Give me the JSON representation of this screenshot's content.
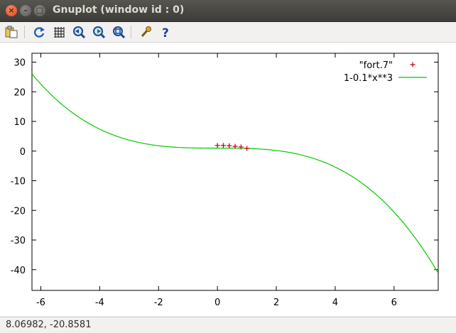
{
  "window": {
    "title": "Gnuplot (window id : 0)",
    "close_glyph": "×",
    "min_glyph": "–",
    "max_glyph": "□"
  },
  "toolbar": {
    "items": [
      {
        "name": "copy-to-clipboard",
        "icon": "clipboard-icon"
      },
      {
        "name": "replot",
        "icon": "refresh-icon"
      },
      {
        "name": "toggle-grid",
        "icon": "grid-icon"
      },
      {
        "name": "previous-zoom",
        "icon": "zoom-back-icon"
      },
      {
        "name": "next-zoom",
        "icon": "zoom-forward-icon"
      },
      {
        "name": "autoscale",
        "icon": "zoom-fit-icon"
      },
      {
        "name": "preferences",
        "icon": "wrench-icon"
      },
      {
        "name": "help",
        "icon": "question-icon"
      }
    ]
  },
  "status": {
    "coords": "8.06982, -20.8581"
  },
  "chart_data": {
    "type": "line",
    "xlim": [
      -6.3,
      7.5
    ],
    "ylim": [
      -47,
      33
    ],
    "xticks": [
      -6,
      -4,
      -2,
      0,
      2,
      4,
      6
    ],
    "yticks": [
      30,
      20,
      10,
      0,
      -10,
      -20,
      -30,
      -40
    ],
    "xtick_labels": [
      "-6",
      "-4",
      "-2",
      "0",
      "2",
      "4",
      "6"
    ],
    "ytick_labels": [
      "30",
      "20",
      "10",
      "0",
      "-10",
      "-20",
      "-30",
      "-40"
    ],
    "grid": false,
    "legend_position": "top-right",
    "series": [
      {
        "name": "\"fort.7\"",
        "style": "points",
        "marker": "+",
        "color": "#c00000",
        "x": [
          0.0,
          0.2,
          0.4,
          0.6,
          0.8,
          1.0
        ],
        "y": [
          1.9,
          1.9,
          1.8,
          1.6,
          1.4,
          0.9
        ]
      },
      {
        "name": "1-0.1*x**3",
        "style": "line",
        "color": "#00cc00",
        "expression": "1-0.1*x**3"
      }
    ]
  }
}
